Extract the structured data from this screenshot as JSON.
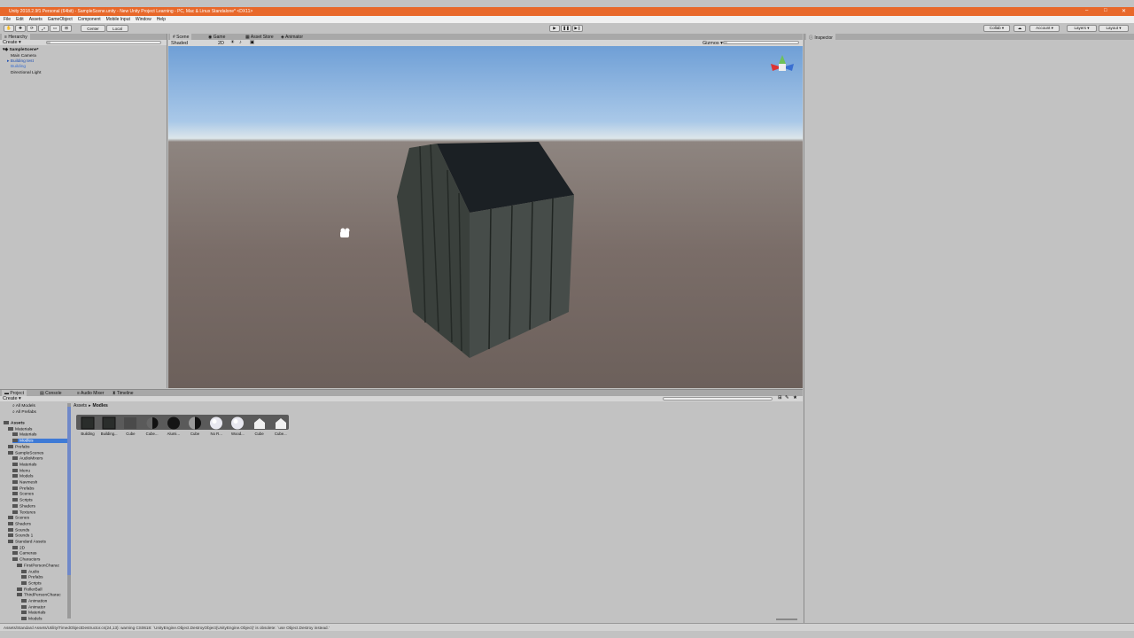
{
  "window": {
    "title": "Unity 2018.2.9f1 Personal (64bit) - SampleScene.unity - New Unity Project Learning - PC, Mac & Linux Standalone* <DX11>"
  },
  "menu": [
    "File",
    "Edit",
    "Assets",
    "GameObject",
    "Component",
    "Mobile Input",
    "Window",
    "Help"
  ],
  "toolbar": {
    "center_label": "Center",
    "local_label": "Local",
    "collab_label": "Collab ▾",
    "account_label": "Account ▾",
    "layers_label": "Layers ▾",
    "layout_label": "Layout ▾"
  },
  "hierarchy": {
    "tab": "Hierarchy",
    "create_label": "Create ▾",
    "search_placeholder": "All",
    "scene_name": "SampleScene*",
    "items": [
      "Main Camera",
      "Building test",
      "Building",
      "Directional Light"
    ]
  },
  "scene_view": {
    "tabs": [
      "Scene",
      "Game",
      "Asset Store",
      "Animator"
    ],
    "shading_mode": "Shaded",
    "mode_2d": "2D",
    "gizmos_label": "Gizmos ▾",
    "search_placeholder": "All"
  },
  "inspector": {
    "tab": "Inspector"
  },
  "project": {
    "tabs": [
      "Project",
      "Console",
      "Audio Mixer",
      "Timeline"
    ],
    "create_label": "Create ▾",
    "favorites": [
      "All Models",
      "All Prefabs"
    ],
    "breadcrumb": [
      "Assets",
      "Modles"
    ],
    "tree": [
      {
        "label": "Assets",
        "depth": 0,
        "bold": true
      },
      {
        "label": "Materials",
        "depth": 1
      },
      {
        "label": "Materials",
        "depth": 2
      },
      {
        "label": "Modles",
        "depth": 2,
        "selected": true
      },
      {
        "label": "Prefabs",
        "depth": 1
      },
      {
        "label": "SampleScenes",
        "depth": 1
      },
      {
        "label": "AudioMixers",
        "depth": 2
      },
      {
        "label": "Materials",
        "depth": 2
      },
      {
        "label": "Menu",
        "depth": 2
      },
      {
        "label": "Models",
        "depth": 2
      },
      {
        "label": "Navmesh",
        "depth": 2
      },
      {
        "label": "Prefabs",
        "depth": 2
      },
      {
        "label": "Scenes",
        "depth": 2
      },
      {
        "label": "Scripts",
        "depth": 2
      },
      {
        "label": "Shaders",
        "depth": 2
      },
      {
        "label": "Textures",
        "depth": 2
      },
      {
        "label": "Scenes",
        "depth": 1
      },
      {
        "label": "Shaders",
        "depth": 1
      },
      {
        "label": "Sounds",
        "depth": 1
      },
      {
        "label": "Sounds 1",
        "depth": 1
      },
      {
        "label": "Standard Assets",
        "depth": 1
      },
      {
        "label": "2D",
        "depth": 2
      },
      {
        "label": "Cameras",
        "depth": 2
      },
      {
        "label": "Characters",
        "depth": 2
      },
      {
        "label": "FirstPersonCharac",
        "depth": 3
      },
      {
        "label": "Audio",
        "depth": 4
      },
      {
        "label": "Prefabs",
        "depth": 4
      },
      {
        "label": "Scripts",
        "depth": 4
      },
      {
        "label": "RollerBall",
        "depth": 3
      },
      {
        "label": "ThirdPersonCharac",
        "depth": 3
      },
      {
        "label": "Animation",
        "depth": 4
      },
      {
        "label": "Animator",
        "depth": 4
      },
      {
        "label": "Materials",
        "depth": 4
      },
      {
        "label": "Models",
        "depth": 4
      }
    ],
    "assets": [
      {
        "label": "Building",
        "kind": "dark-cube"
      },
      {
        "label": "Building...",
        "kind": "dark-cube"
      },
      {
        "label": "Cube",
        "kind": "dark"
      },
      {
        "label": "Cube...",
        "kind": "half"
      },
      {
        "label": "Alumi...",
        "kind": "black-sphere"
      },
      {
        "label": "Cube",
        "kind": "half-sphere"
      },
      {
        "label": "No R...",
        "kind": "white-sphere"
      },
      {
        "label": "Wood...",
        "kind": "white-sphere"
      },
      {
        "label": "Cube",
        "kind": "house"
      },
      {
        "label": "Cube...",
        "kind": "house"
      }
    ]
  },
  "status": {
    "message": "Assets/Standard Assets/Utility/TimedObjectDestructor.cs(24,13): warning CS0618: `UnityEngine.Object.DestroyObject(UnityEngine.Object)' is obsolete: `use Object.Destroy instead.'"
  },
  "colors": {
    "title_bar": "#e8682a",
    "panel_bg": "#c2c2c2",
    "selected": "#3e7ad6"
  }
}
